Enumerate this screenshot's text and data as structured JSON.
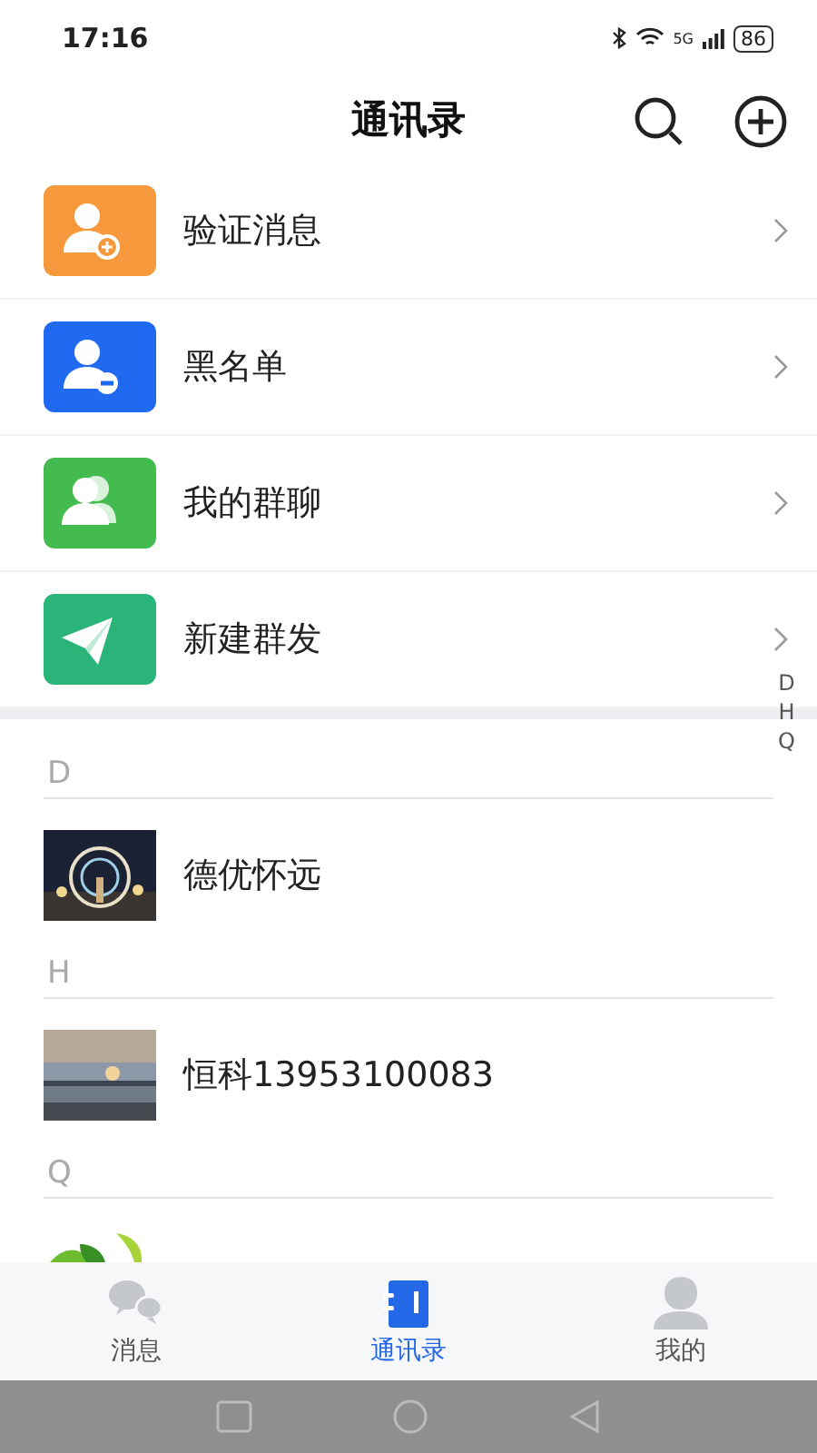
{
  "status_bar": {
    "time": "17:16",
    "battery": "86",
    "network": "5G"
  },
  "header": {
    "title": "通讯录"
  },
  "menu_items": [
    {
      "label": "验证消息",
      "kind": "verify",
      "color": "#f5993c"
    },
    {
      "label": "黑名单",
      "kind": "blacklist",
      "color": "#1f6af0"
    },
    {
      "label": "我的群聊",
      "kind": "groups",
      "color": "#44bb4f"
    },
    {
      "label": "新建群发",
      "kind": "broadcast",
      "color": "#2bb47a"
    }
  ],
  "index_bar": [
    "D",
    "H",
    "Q"
  ],
  "sections": [
    {
      "letter": "D",
      "contacts": [
        {
          "name": "德优怀远",
          "kind": "picture"
        }
      ]
    },
    {
      "letter": "H",
      "contacts": [
        {
          "name": "恒科13953100083",
          "kind": "picture"
        }
      ]
    },
    {
      "letter": "Q"
    }
  ],
  "tab_bar": [
    {
      "label": "消息",
      "kind": "chat",
      "selected": false
    },
    {
      "label": "通讯录",
      "kind": "contacts",
      "selected": true
    },
    {
      "label": "我的",
      "kind": "profile",
      "selected": false
    }
  ]
}
